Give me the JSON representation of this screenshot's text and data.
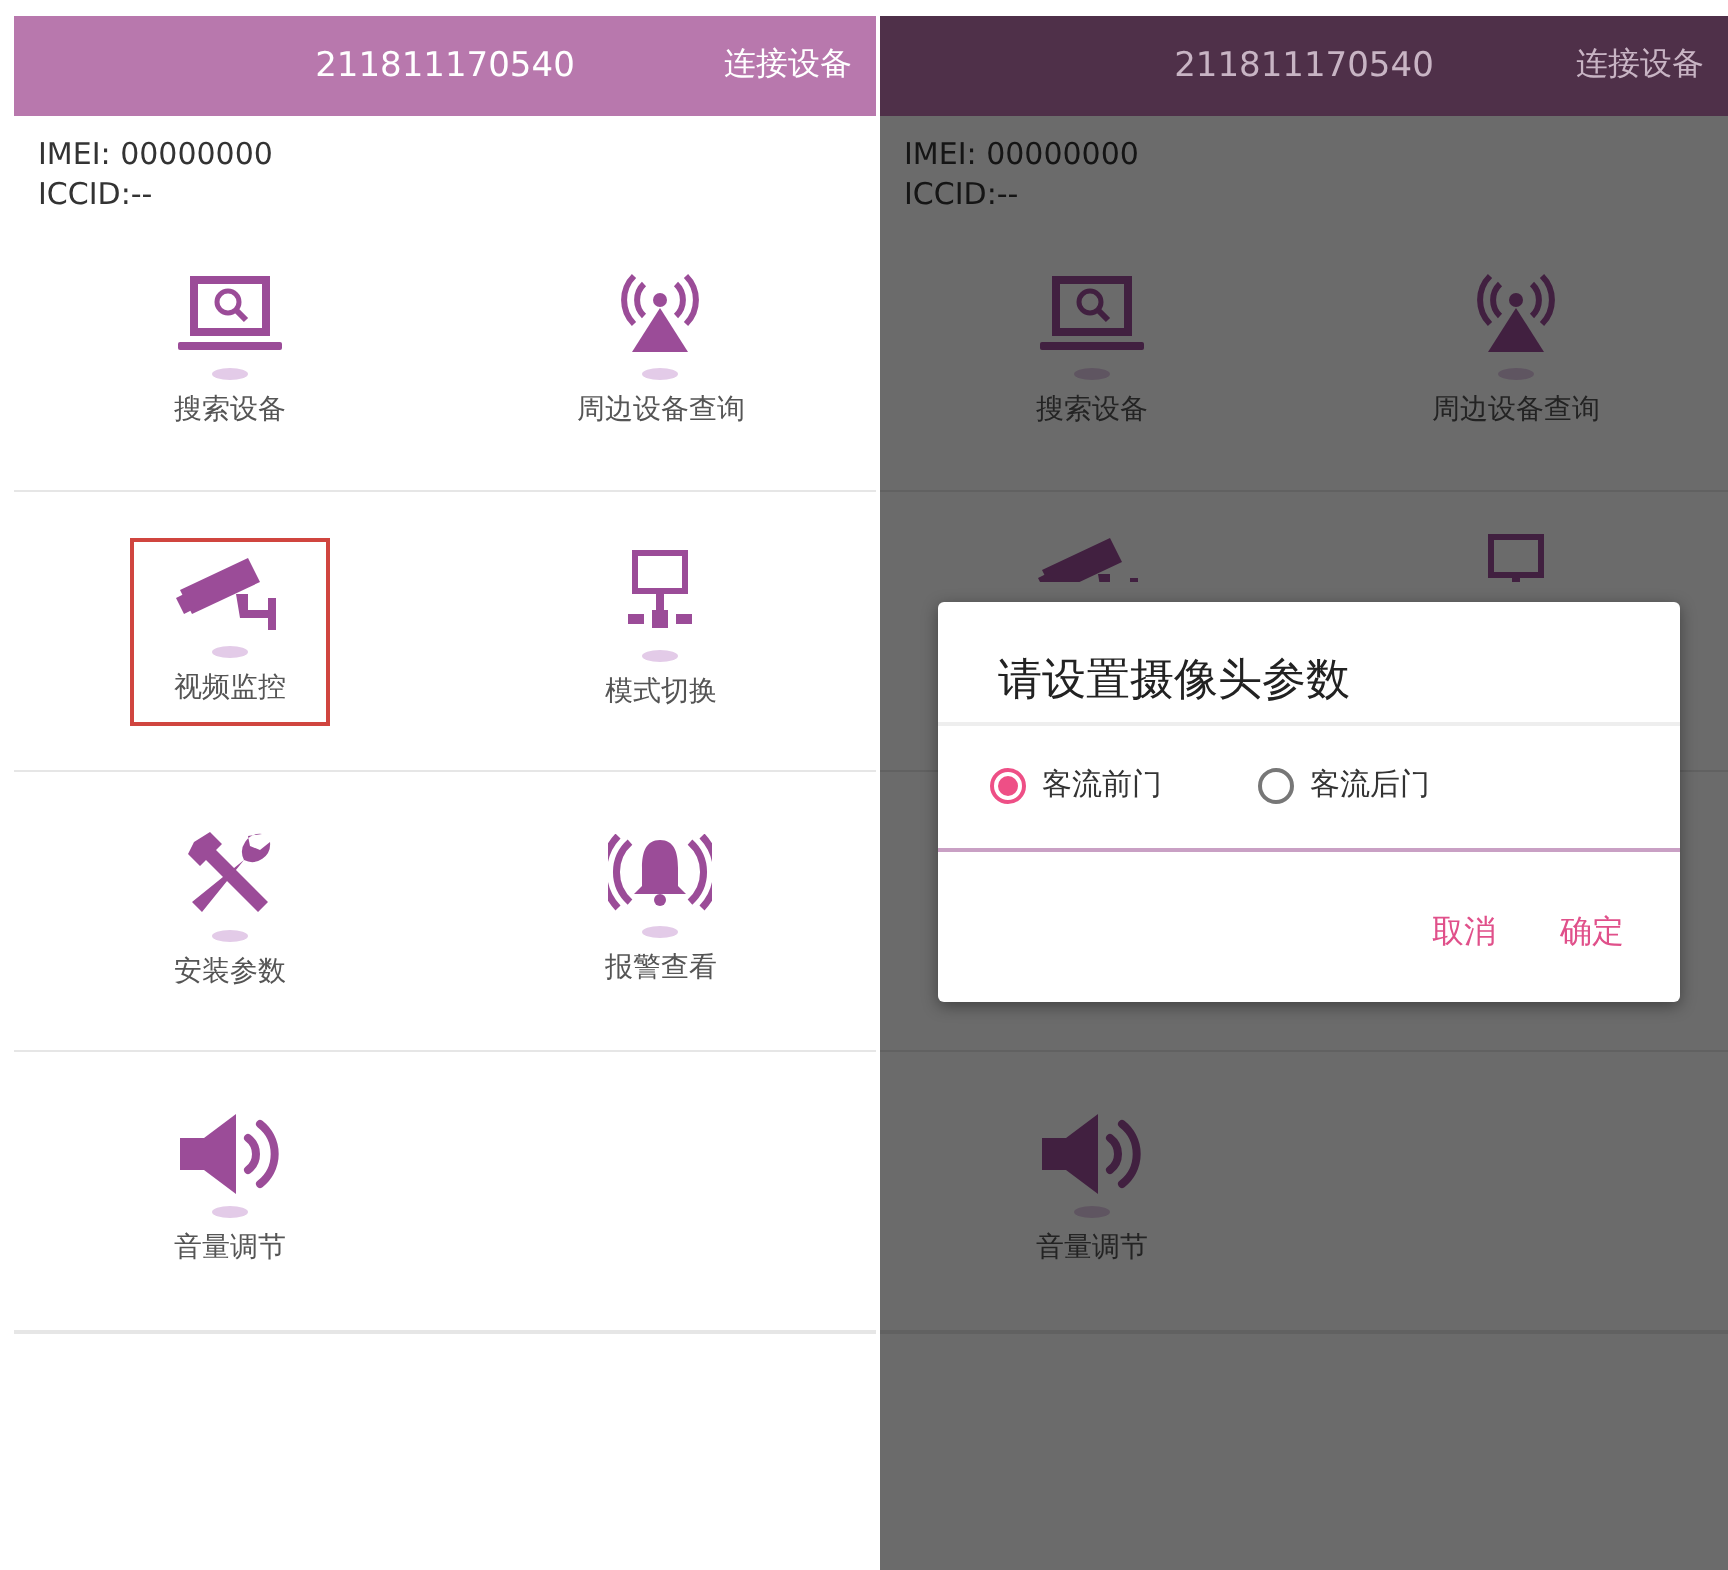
{
  "screens": [
    {
      "dimmed": false,
      "header": {
        "title": "211811170540",
        "action": "连接设备"
      },
      "imei": "IMEI: 00000000",
      "iccid": "ICCID:--",
      "rows": [
        {
          "items": [
            {
              "kind": "laptop-search",
              "label": "搜索设备",
              "highlighted": false
            },
            {
              "kind": "antenna",
              "label": "周边设备查询",
              "highlighted": false
            }
          ]
        },
        {
          "items": [
            {
              "kind": "camera",
              "label": "视频监控",
              "highlighted": true
            },
            {
              "kind": "network",
              "label": "模式切换",
              "highlighted": false
            }
          ]
        },
        {
          "items": [
            {
              "kind": "tools",
              "label": "安装参数",
              "highlighted": false
            },
            {
              "kind": "bell",
              "label": "报警查看",
              "highlighted": false
            }
          ]
        },
        {
          "items": [
            {
              "kind": "speaker",
              "label": "音量调节",
              "highlighted": false
            }
          ]
        }
      ]
    },
    {
      "dimmed": true,
      "header": {
        "title": "211811170540",
        "action": "连接设备"
      },
      "imei": "IMEI: 00000000",
      "iccid": "ICCID:--",
      "rows": [
        {
          "items": [
            {
              "kind": "laptop-search",
              "label": "搜索设备",
              "highlighted": false
            },
            {
              "kind": "antenna",
              "label": "周边设备查询",
              "highlighted": false
            }
          ]
        },
        {
          "items": [
            {
              "kind": "camera"
            },
            {
              "kind": "network"
            }
          ]
        },
        {
          "covered": true
        },
        {
          "items": [
            {
              "kind": "speaker",
              "label": "音量调节",
              "highlighted": false
            }
          ]
        }
      ],
      "dialog": {
        "title": "请设置摄像头参数",
        "options": [
          {
            "label": "客流前门",
            "selected": true
          },
          {
            "label": "客流后门",
            "selected": false
          }
        ],
        "buttons": [
          "取消",
          "确定"
        ]
      }
    }
  ]
}
